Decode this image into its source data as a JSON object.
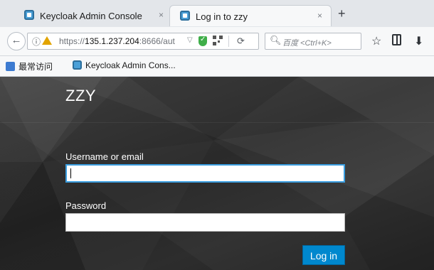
{
  "browser": {
    "tabs": [
      {
        "label": "Keycloak Admin Console",
        "active": false
      },
      {
        "label": "Log in to zzy",
        "active": true
      }
    ],
    "new_tab": "+",
    "tab_close": "×",
    "url_prefix": "https://",
    "url_host": "135.1.237.204",
    "url_rest": ":8666/aut",
    "search_placeholder": "百度 <Ctrl+K>",
    "bookmarks": [
      {
        "label": "最常访问"
      },
      {
        "label": "Keycloak Admin Cons..."
      }
    ]
  },
  "login": {
    "realm": "ZZY",
    "username_label": "Username or email",
    "username_value": "",
    "password_label": "Password",
    "password_value": "",
    "submit_label": "Log in"
  },
  "colors": {
    "accent": "#0088ce",
    "focus_border": "#3b9ee0",
    "page_bg": "#333333"
  }
}
